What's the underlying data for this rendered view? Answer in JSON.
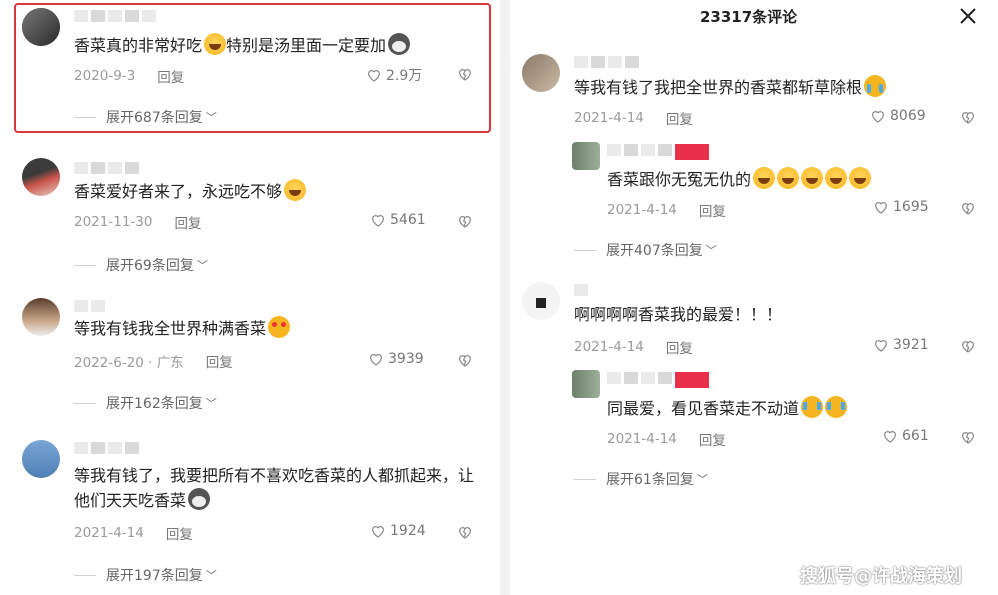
{
  "header": {
    "comment_count_title": "23317条评论"
  },
  "watermark": "搜狐号@许战海策划",
  "left_comments": [
    {
      "text": "香菜真的非常好吃",
      "text2": "特别是汤里面一定要加",
      "date": "2020-9-3",
      "reply": "回复",
      "likes": "2.9万",
      "expand": "展开687条回复"
    },
    {
      "text": "香菜爱好者来了，永远吃不够",
      "date": "2021-11-30",
      "reply": "回复",
      "likes": "5461",
      "expand": "展开69条回复"
    },
    {
      "text": "等我有钱我全世界种满香菜",
      "date": "2022-6-20 · 广东",
      "reply": "回复",
      "likes": "3939",
      "expand": "展开162条回复"
    },
    {
      "text": "等我有钱了，我要把所有不喜欢吃香菜的人都抓起来，让他们天天吃香菜",
      "date": "2021-4-14",
      "reply": "回复",
      "likes": "1924",
      "expand": "展开197条回复"
    }
  ],
  "right_comments": [
    {
      "text": "等我有钱了我把全世界的香菜都斩草除根",
      "date": "2021-4-14",
      "reply": "回复",
      "likes": "8069",
      "sub": {
        "text": "香菜跟你无冤无仇的",
        "date": "2021-4-14",
        "reply": "回复",
        "likes": "1695"
      },
      "expand": "展开407条回复"
    },
    {
      "text": "啊啊啊啊香菜我的最爱！！！",
      "date": "2021-4-14",
      "reply": "回复",
      "likes": "3921",
      "sub": {
        "text": "同最爱，看见香菜走不动道",
        "date": "2021-4-14",
        "reply": "回复",
        "likes": "661"
      },
      "expand": "展开61条回复"
    }
  ],
  "icons": {
    "like": "heart-outline-icon",
    "dislike": "broken-heart-icon",
    "expand": "chevron-down-icon",
    "close": "close-icon"
  },
  "colors": {
    "highlight_border": "#d9353a",
    "meta_text": "#9a9a9a"
  }
}
